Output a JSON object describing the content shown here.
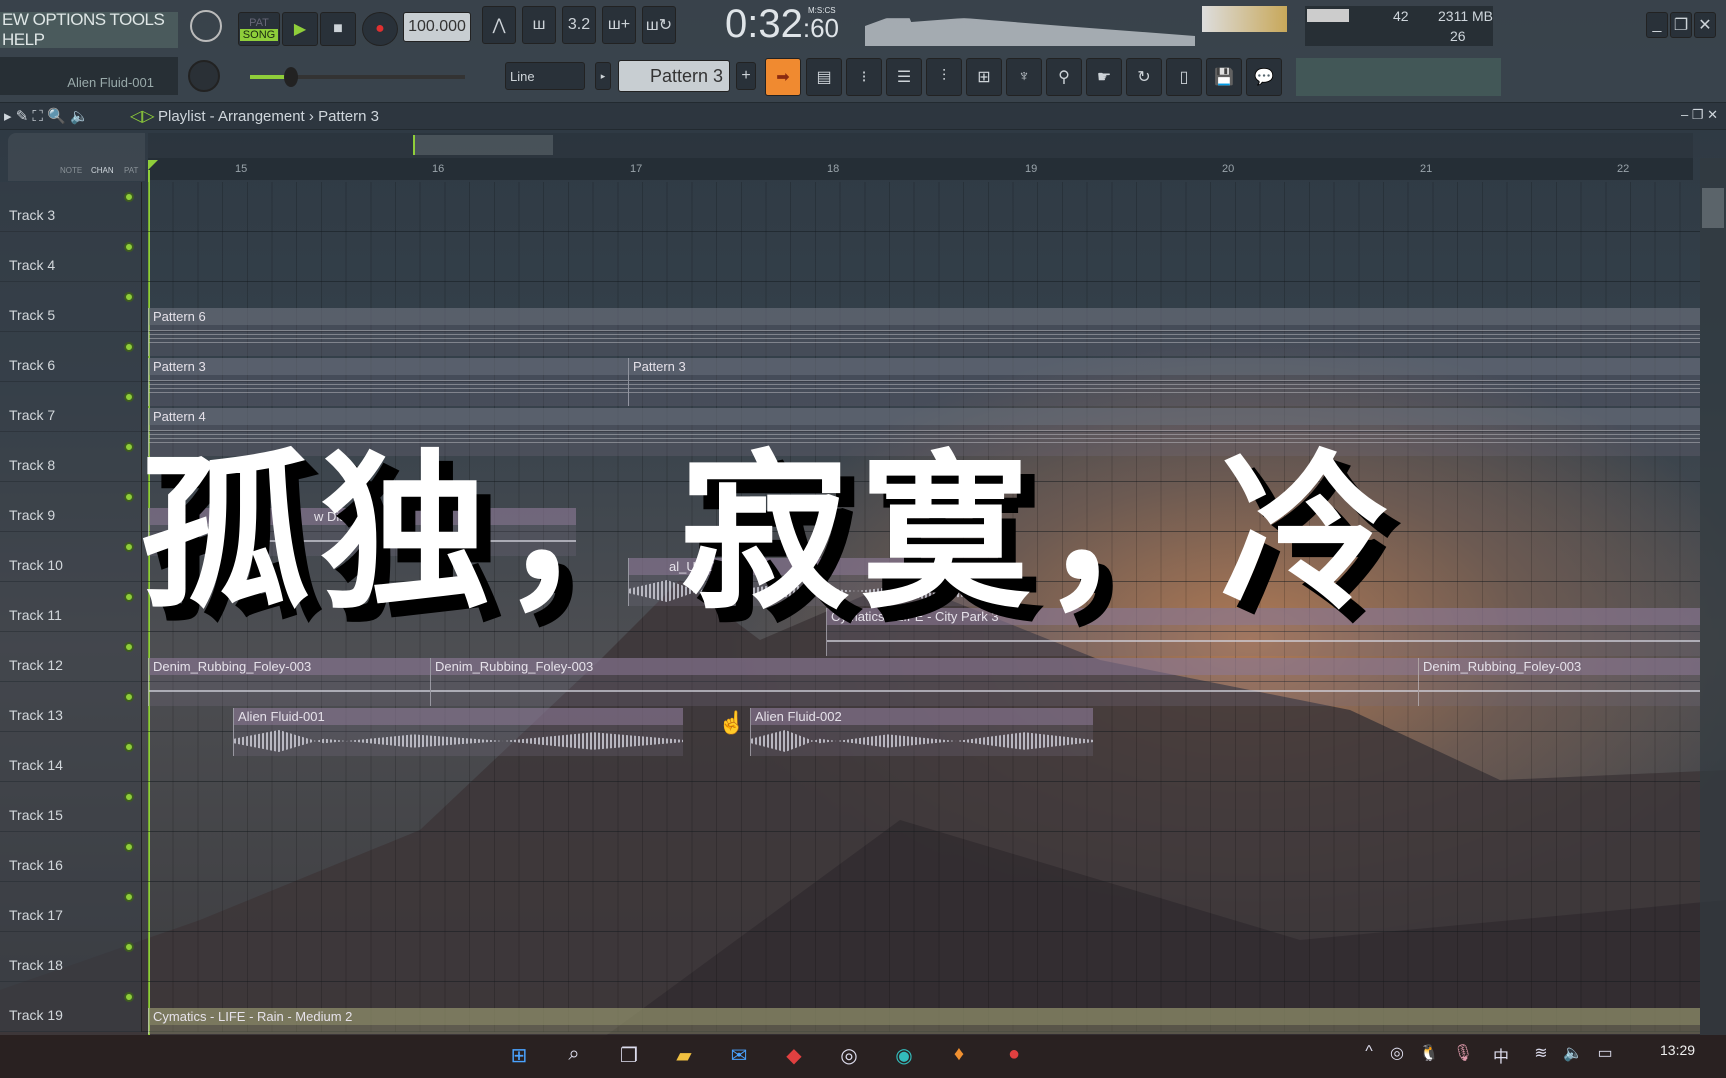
{
  "menu": {
    "text": "EW OPTIONS TOOLS HELP"
  },
  "transport": {
    "mode_pat": "PAT",
    "mode_song": "SONG",
    "tempo": "100.000",
    "time": "0:32",
    "time_cs": "60",
    "time_format": "M:S:CS"
  },
  "toolbar": {
    "channel_name": "Alien Fluid-001",
    "snap": "Line",
    "pattern": "Pattern 3",
    "pattern_add": "+"
  },
  "monitor": {
    "cpu": "42",
    "memory": "2311 MB",
    "polyphony": "26"
  },
  "playlist": {
    "title": "Playlist - Arrangement",
    "separator": "›",
    "pattern": "Pattern 3",
    "tabs": [
      "NOTE",
      "CHAN",
      "PAT"
    ]
  },
  "ruler": [
    "15",
    "16",
    "17",
    "18",
    "19",
    "20",
    "21",
    "22"
  ],
  "tracks": [
    "Track 3",
    "Track 4",
    "Track 5",
    "Track 6",
    "Track 7",
    "Track 8",
    "Track 9",
    "Track 10",
    "Track 11",
    "Track 12",
    "Track 13",
    "Track 14",
    "Track 15",
    "Track 16",
    "Track 17",
    "Track 18",
    "Track 19"
  ],
  "clips": {
    "t5a": "Pattern 6",
    "t6a": "Pattern 3",
    "t6b": "Pattern 3",
    "t7a": "Pattern 4",
    "t9a": "w Distant",
    "t10a": "al_UI_Chime_02",
    "t11a": "Cymatics - LIFE - City Park 3",
    "t12a": "Denim_Rubbing_Foley-003",
    "t12b": "Denim_Rubbing_Foley-003",
    "t12c": "Denim_Rubbing_Foley-003",
    "t13a": "Alien Fluid-001",
    "t13b": "Alien Fluid-002",
    "t19a": "Cymatics - LIFE - Rain - Medium 2"
  },
  "overlay_caption": "孤独，寂寞，冷",
  "taskbar": {
    "time": "13:29",
    "ime": "中"
  },
  "colors": {
    "accent_green": "#8fce3a",
    "record_red": "#e03030",
    "arrow_orange": "#f08a30"
  }
}
